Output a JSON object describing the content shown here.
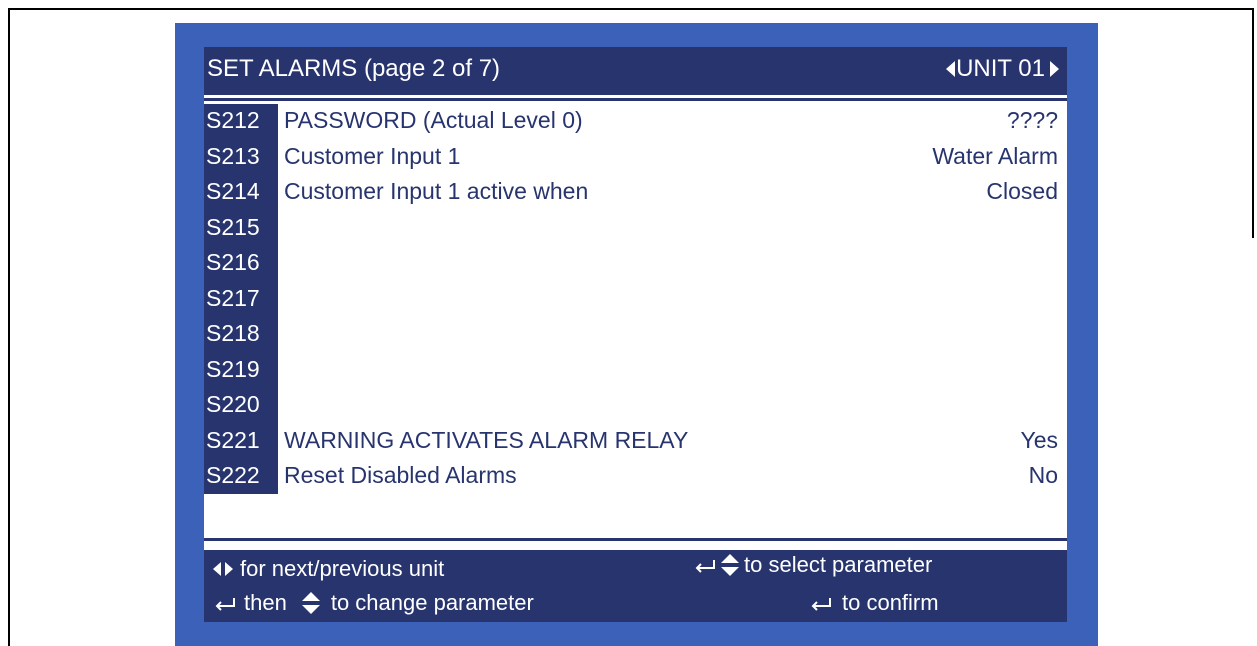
{
  "header": {
    "title": "SET ALARMS (page 2 of 7)",
    "unit": "UNIT 01",
    "unit_prev_icon": "triangle-left-icon",
    "unit_next_icon": "triangle-right-icon"
  },
  "parameters": [
    {
      "code": "S212",
      "label": "PASSWORD  (Actual Level  0)",
      "value": "????"
    },
    {
      "code": "S213",
      "label": "Customer Input 1",
      "value": "Water Alarm"
    },
    {
      "code": "S214",
      "label": "Customer Input 1 active when",
      "value": "Closed"
    },
    {
      "code": "S215",
      "label": "",
      "value": ""
    },
    {
      "code": "S216",
      "label": "",
      "value": ""
    },
    {
      "code": "S217",
      "label": "",
      "value": ""
    },
    {
      "code": "S218",
      "label": "",
      "value": ""
    },
    {
      "code": "S219",
      "label": "",
      "value": ""
    },
    {
      "code": "S220",
      "label": "",
      "value": ""
    },
    {
      "code": "S221",
      "label": "WARNING ACTIVATES ALARM RELAY",
      "value": "Yes"
    },
    {
      "code": "S222",
      "label": "Reset Disabled Alarms",
      "value": "No"
    }
  ],
  "footer": {
    "next_prev": "for next/previous unit",
    "select": "to select parameter",
    "then": "then",
    "change": "to change parameter",
    "confirm": "to confirm",
    "icons": [
      "left-right-arrows-icon",
      "enter-icon",
      "up-down-arrows-icon"
    ]
  },
  "colors": {
    "bezel": "#3b62b8",
    "panel": "#27346e",
    "screen": "#ffffff",
    "text_on_screen": "#27346e"
  }
}
